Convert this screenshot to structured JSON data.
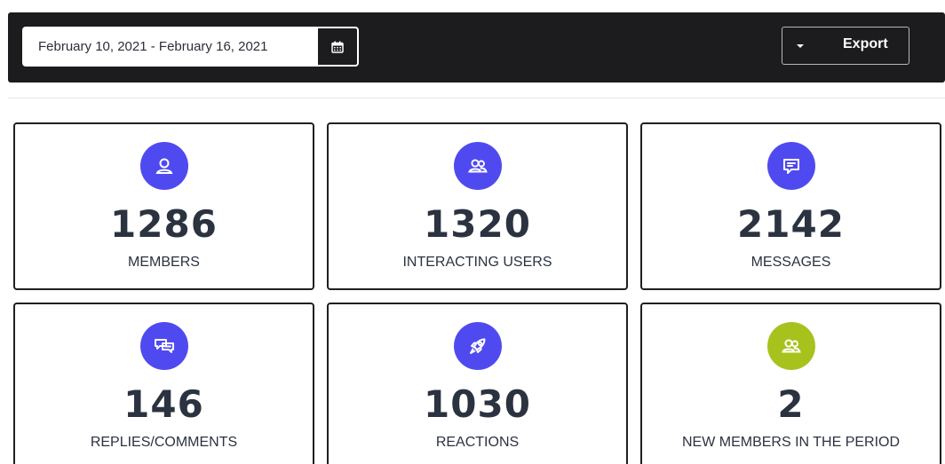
{
  "toolbar": {
    "date_range": "February 10, 2021 - February 16, 2021",
    "calendar_icon": "calendar-icon",
    "export_label": "Export",
    "export_icon": "caret-down-icon"
  },
  "colors": {
    "toolbar_bg": "#1c1c1e",
    "icon_blue": "#4f4af0",
    "icon_green": "#a7c21d",
    "text": "#2b3240"
  },
  "stats": [
    {
      "value": "1286",
      "label": "MEMBERS",
      "icon": "user-icon",
      "icon_color": "#4f4af0"
    },
    {
      "value": "1320",
      "label": "INTERACTING USERS",
      "icon": "users-icon",
      "icon_color": "#4f4af0"
    },
    {
      "value": "2142",
      "label": "MESSAGES",
      "icon": "message-icon",
      "icon_color": "#4f4af0"
    },
    {
      "value": "146",
      "label": "REPLIES/COMMENTS",
      "icon": "comments-icon",
      "icon_color": "#4f4af0"
    },
    {
      "value": "1030",
      "label": "REACTIONS",
      "icon": "rocket-icon",
      "icon_color": "#4f4af0"
    },
    {
      "value": "2",
      "label": "NEW MEMBERS IN THE PERIOD",
      "icon": "new-users-icon",
      "icon_color": "#a7c21d"
    }
  ]
}
